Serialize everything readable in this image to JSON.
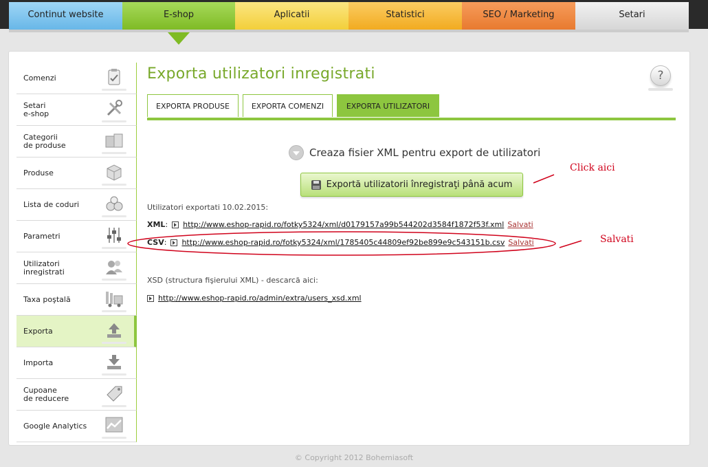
{
  "nav": {
    "tabs": [
      {
        "label": "Continut website",
        "color": "#68b7e8"
      },
      {
        "label": "E-shop",
        "color": "#7fbb25",
        "active": true
      },
      {
        "label": "Aplicatii",
        "color": "#f3cf3a"
      },
      {
        "label": "Statistici",
        "color": "#f2ab20"
      },
      {
        "label": "SEO / Marketing",
        "color": "#e87a2f"
      },
      {
        "label": "Setari",
        "color": "#d6d6d6"
      }
    ]
  },
  "sidebar": {
    "items": [
      {
        "label": "Comenzi",
        "icon": "clipboard-icon"
      },
      {
        "label": "Setari\ne-shop",
        "icon": "tools-icon"
      },
      {
        "label": "Categorii\nde produse",
        "icon": "boxes-icon"
      },
      {
        "label": "Produse",
        "icon": "box-icon"
      },
      {
        "label": "Lista de coduri",
        "icon": "codes-icon"
      },
      {
        "label": "Parametri",
        "icon": "sliders-icon"
      },
      {
        "label": "Utilizatori\ninregistrati",
        "icon": "users-icon"
      },
      {
        "label": "Taxa poştală",
        "icon": "truck-icon"
      },
      {
        "label": "Exporta",
        "icon": "upload-icon",
        "active": true
      },
      {
        "label": "Importa",
        "icon": "download-icon"
      },
      {
        "label": "Cupoane\nde reducere",
        "icon": "tag-icon"
      },
      {
        "label": "Google Analytics",
        "icon": "chart-icon"
      }
    ]
  },
  "main": {
    "title": "Exporta utilizatori inregistrati",
    "help": "?",
    "subtabs": [
      "EXPORTA PRODUSE",
      "EXPORTA COMENZI",
      "EXPORTA UTILIZATORI"
    ],
    "create_label": "Creaza fisier XML pentru export de utilizatori",
    "export_button": "Exportă utilizatorii înregistraţi până acum",
    "exported_label": "Utilizatori exportati 10.02.2015:",
    "xml": {
      "label": "XML",
      "url": "http://www.eshop-rapid.ro/fotky5324/xml/d0179157a99b544202d3584f1872f53f.xml",
      "saved": "Salvati"
    },
    "csv": {
      "label": "CSV",
      "url": "http://www.eshop-rapid.ro/fotky5324/xml/1785405c44809ef92be899e9c543151b.csv",
      "saved": "Salvati"
    },
    "xsd_label": "XSD (structura fişierului XML) - descarcă aici:",
    "xsd_url": "http://www.eshop-rapid.ro/admin/extra/users_xsd.xml"
  },
  "annotations": {
    "click": "Click  aici",
    "saved": "Salvati",
    "color": "#d0021b"
  },
  "footer": "© Copyright 2012 Bohemiasoft"
}
